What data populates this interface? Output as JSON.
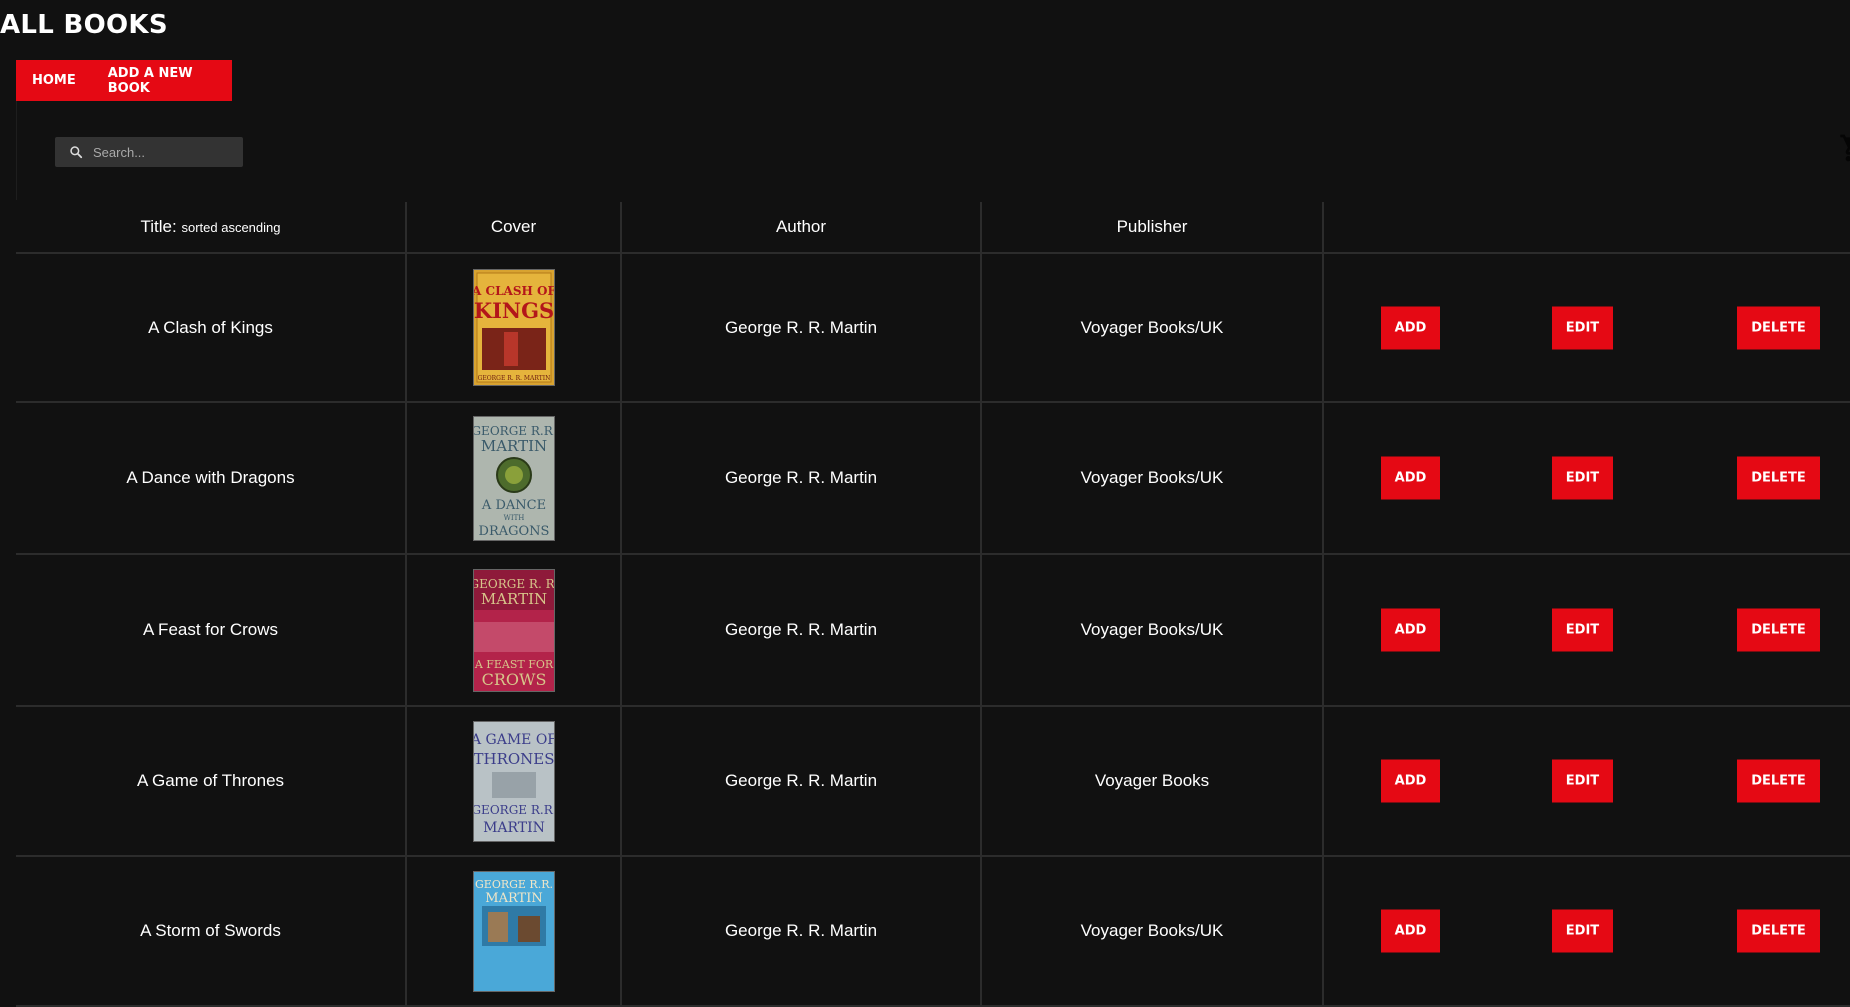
{
  "page": {
    "title": "ALL BOOKS"
  },
  "nav": {
    "home_label": "HOME",
    "add_book_label": "ADD A NEW BOOK",
    "accent_color": "#e50914"
  },
  "search": {
    "placeholder": "Search...",
    "value": "",
    "icon": "search-icon"
  },
  "cart": {
    "icon": "shopping-cart-icon"
  },
  "table": {
    "columns": {
      "title": "Title",
      "title_sort_note": "sorted ascending",
      "cover": "Cover",
      "author": "Author",
      "publisher": "Publisher",
      "actions": ""
    },
    "rows": [
      {
        "title": "A Clash of Kings",
        "author": "George R. R. Martin",
        "publisher": "Voyager Books/UK",
        "cover_lines": [
          "A CLASH OF",
          "KINGS",
          "GEORGE R. R. MARTIN"
        ]
      },
      {
        "title": "A Dance with Dragons",
        "author": "George R. R. Martin",
        "publisher": "Voyager Books/UK",
        "cover_lines": [
          "GEORGE R.R.",
          "MARTIN",
          "A DANCE",
          "WITH",
          "DRAGONS"
        ]
      },
      {
        "title": "A Feast for Crows",
        "author": "George R. R. Martin",
        "publisher": "Voyager Books/UK",
        "cover_lines": [
          "GEORGE R. R.",
          "MARTIN",
          "A FEAST FOR",
          "CROWS"
        ]
      },
      {
        "title": "A Game of Thrones",
        "author": "George R. R. Martin",
        "publisher": "Voyager Books",
        "cover_lines": [
          "A GAME OF",
          "THRONES",
          "GEORGE R.R.",
          "MARTIN"
        ]
      },
      {
        "title": "A Storm of Swords",
        "author": "George R. R. Martin",
        "publisher": "Voyager Books/UK",
        "cover_lines": [
          "GEORGE R.R.",
          "MARTIN"
        ]
      }
    ],
    "buttons": {
      "add": "ADD",
      "edit": "EDIT",
      "delete": "DELETE"
    }
  }
}
